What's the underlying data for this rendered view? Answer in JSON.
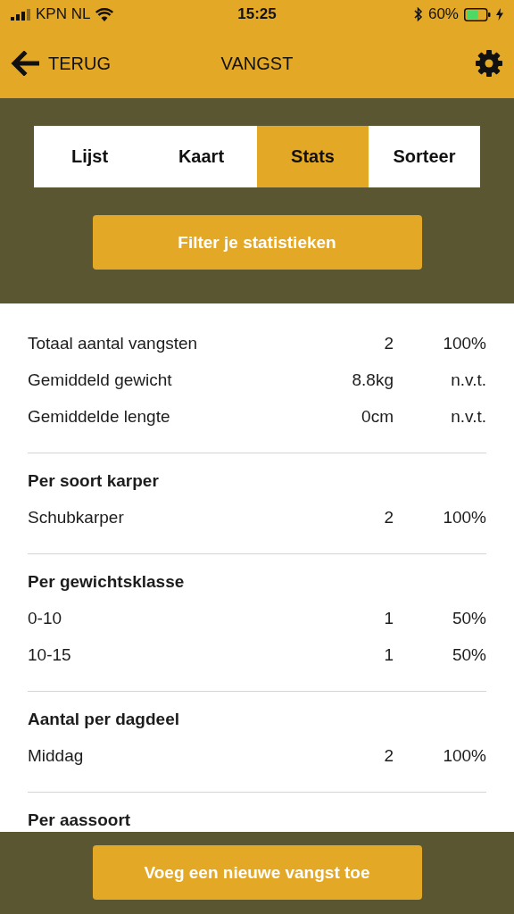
{
  "status_bar": {
    "carrier": "KPN NL",
    "time": "15:25",
    "battery": "60%"
  },
  "nav": {
    "back": "TERUG",
    "title": "VANGST"
  },
  "tabs": [
    {
      "label": "Lijst",
      "selected": false
    },
    {
      "label": "Kaart",
      "selected": false
    },
    {
      "label": "Stats",
      "selected": true
    },
    {
      "label": "Sorteer",
      "selected": false
    }
  ],
  "filter_button": "Filter je statistieken",
  "sections": [
    {
      "rows": [
        {
          "label": "Totaal aantal vangsten",
          "count": "2",
          "percent": "100%"
        },
        {
          "label": "Gemiddeld gewicht",
          "count": "8.8kg",
          "percent": "n.v.t."
        },
        {
          "label": "Gemiddelde lengte",
          "count": "0cm",
          "percent": "n.v.t."
        }
      ]
    },
    {
      "heading": "Per soort karper",
      "rows": [
        {
          "label": "Schubkarper",
          "count": "2",
          "percent": "100%"
        }
      ]
    },
    {
      "heading": "Per gewichtsklasse",
      "rows": [
        {
          "label": "0-10",
          "count": "1",
          "percent": "50%"
        },
        {
          "label": "10-15",
          "count": "1",
          "percent": "50%"
        }
      ]
    },
    {
      "heading": "Aantal per dagdeel",
      "rows": [
        {
          "label": "Middag",
          "count": "2",
          "percent": "100%"
        }
      ]
    },
    {
      "heading": "Per aassoort"
    }
  ],
  "bottom_button": "Voeg een nieuwe vangst toe"
}
